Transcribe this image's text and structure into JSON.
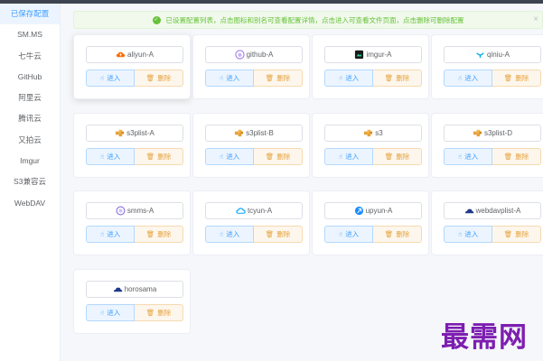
{
  "sidebar": {
    "items": [
      {
        "label": "已保存配置",
        "active": true
      },
      {
        "label": "SM.MS"
      },
      {
        "label": "七牛云"
      },
      {
        "label": "GitHub"
      },
      {
        "label": "阿里云"
      },
      {
        "label": "腾讯云"
      },
      {
        "label": "又拍云"
      },
      {
        "label": "Imgur"
      },
      {
        "label": "S3兼容云"
      },
      {
        "label": "WebDAV"
      }
    ]
  },
  "alert": {
    "text": "已设置配置列表，点击图标和别名可查看配置详情，点击进入可查看文件页面，点击删除可删除配置",
    "close": "×"
  },
  "buttons": {
    "enter": "进入",
    "delete": "删除"
  },
  "configs": [
    {
      "name": "aliyun-A",
      "icon": "aliyun-icon"
    },
    {
      "name": "github-A",
      "icon": "github-icon"
    },
    {
      "name": "imgur-A",
      "icon": "imgur-icon"
    },
    {
      "name": "qiniu-A",
      "icon": "qiniu-icon"
    },
    {
      "name": "s3plist-A",
      "icon": "s3-icon"
    },
    {
      "name": "s3plist-B",
      "icon": "s3-icon"
    },
    {
      "name": "s3",
      "icon": "s3-icon"
    },
    {
      "name": "s3plist-D",
      "icon": "s3-icon"
    },
    {
      "name": "smms-A",
      "icon": "smms-icon"
    },
    {
      "name": "tcyun-A",
      "icon": "tcyun-icon"
    },
    {
      "name": "upyun-A",
      "icon": "upyun-icon"
    },
    {
      "name": "webdavplist-A",
      "icon": "webdav-icon"
    },
    {
      "name": "horosama",
      "icon": "webdav-icon"
    }
  ],
  "watermark": "最需网",
  "colors": {
    "primary": "#409eff",
    "warning": "#e6a23c",
    "success": "#67c23a",
    "watermark": "#7d1eb0"
  }
}
